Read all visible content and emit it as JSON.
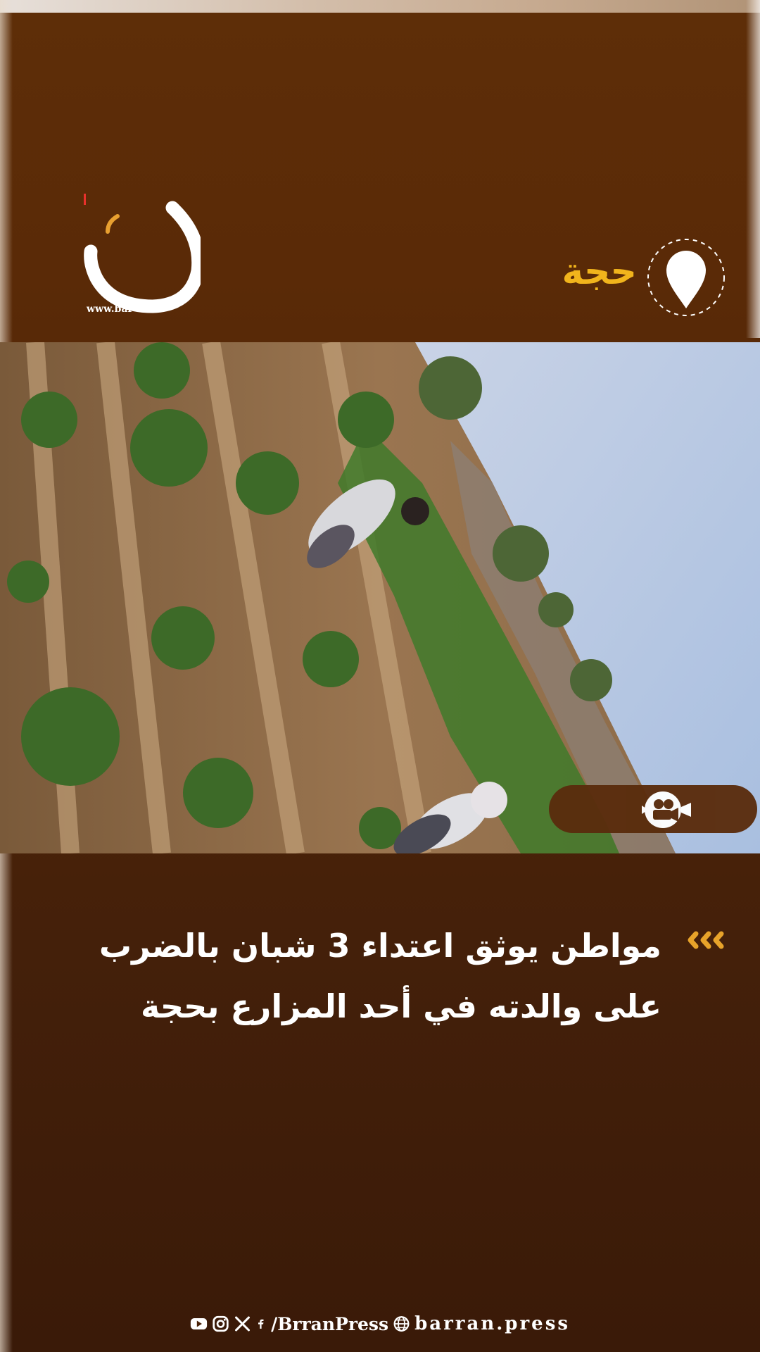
{
  "header": {
    "logo_url": "www.bar",
    "location": "حجة",
    "accent_color": "#f1b41c",
    "icons": [
      "logo-mark-icon",
      "location-pin-icon"
    ]
  },
  "media": {
    "description_icon": "video-camera-icon"
  },
  "headline": {
    "line1": "مواطن يوثق اعتداء 3 شبان بالضرب",
    "line2": "على والدته في أحد المزارع بحجة",
    "bullet_icon": "triple-chevron-icon"
  },
  "footer": {
    "social_icons": [
      "youtube-icon",
      "instagram-icon",
      "x-icon",
      "facebook-icon"
    ],
    "handle": "/BrranPress",
    "site": "barran.press",
    "site_icon": "globe-icon"
  }
}
